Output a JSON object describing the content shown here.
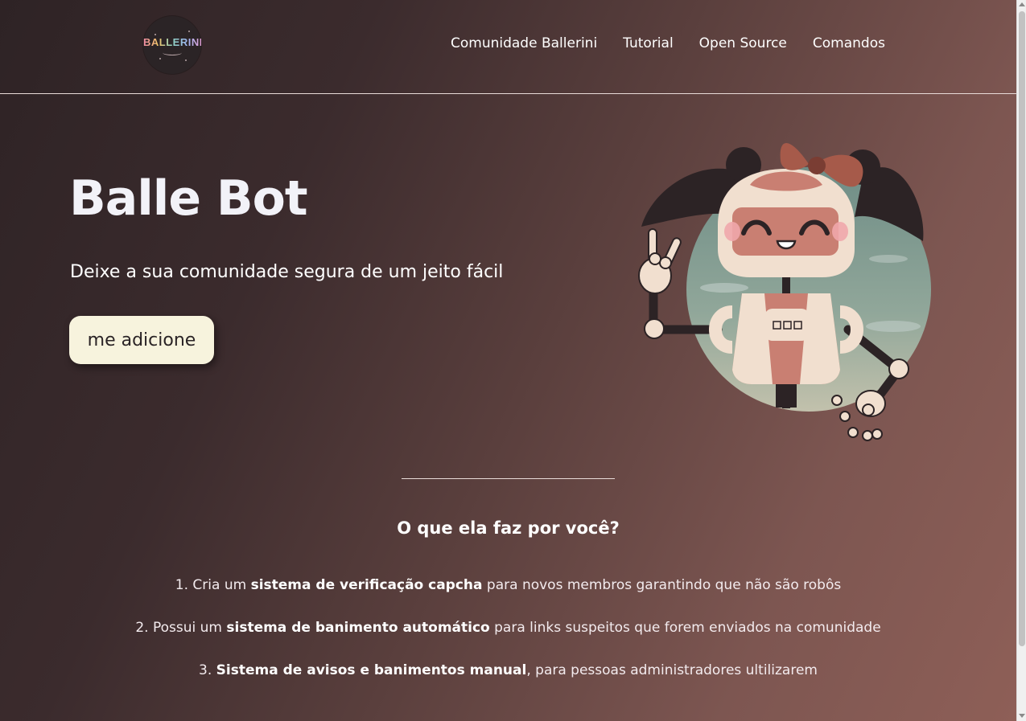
{
  "header": {
    "logo_text": "BALLERINI",
    "nav": [
      {
        "label": "Comunidade Ballerini"
      },
      {
        "label": "Tutorial"
      },
      {
        "label": "Open Source"
      },
      {
        "label": "Comandos"
      }
    ]
  },
  "hero": {
    "title": "Balle Bot",
    "subtitle": "Deixe a sua comunidade segura de um jeito fácil",
    "button_label": "me adicione"
  },
  "features": {
    "title": "O que ela faz por você?",
    "items": [
      {
        "number": "1.",
        "before": "Cria um",
        "bold": "sistema de verificação capcha",
        "after": "para novos membros garantindo que não são robôs"
      },
      {
        "number": "2.",
        "before": "Possui um",
        "bold": "sistema de banimento automático",
        "after": "para links suspeitos que forem enviados na comunidade"
      },
      {
        "number": "3.",
        "before": "",
        "bold": "Sistema de avisos e banimentos manual",
        "after": ", para pessoas administradores ultilizarem"
      }
    ]
  },
  "colors": {
    "gradient_dark": "#2e2325",
    "gradient_light": "#8e5f57",
    "button_bg": "#f7f3dd",
    "robot_pink": "#c97f72",
    "robot_cream": "#f1dfcf"
  },
  "icons": {
    "logo": "ballerini-logo",
    "illustration": "robot-girl-illustration"
  }
}
